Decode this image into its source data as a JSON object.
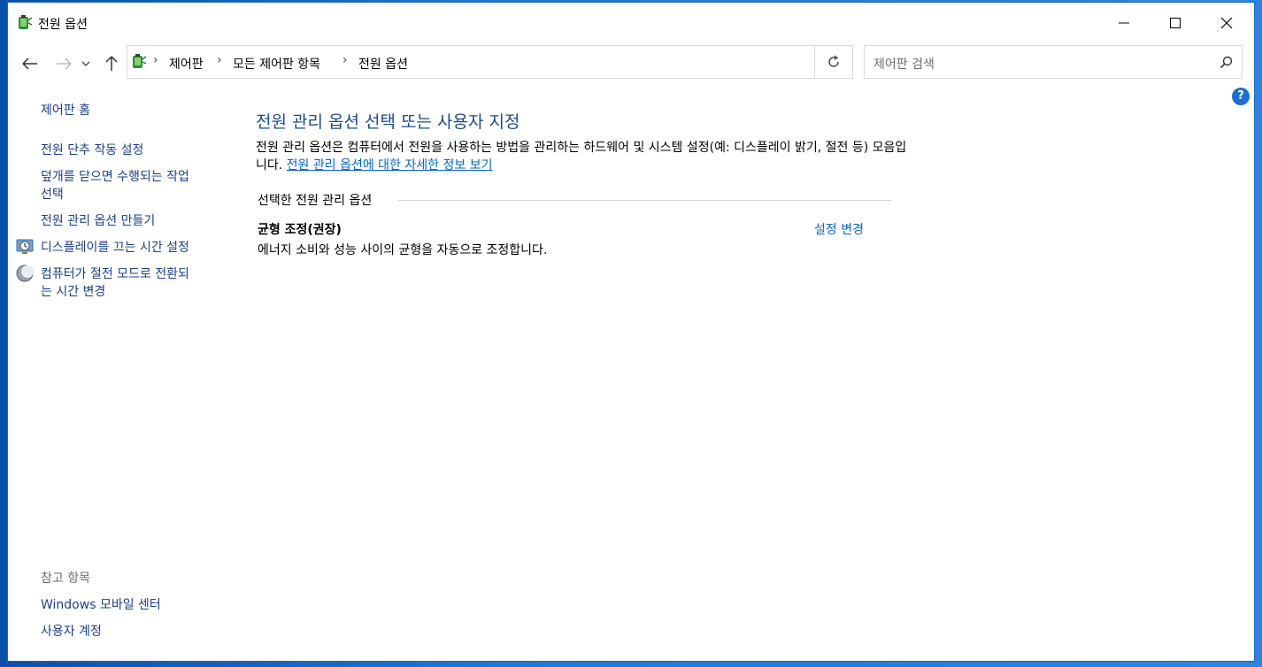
{
  "window": {
    "title": "전원 옵션",
    "minimize_glyph": "—",
    "maximize_glyph": "□",
    "close_glyph": "✕"
  },
  "navigation": {
    "back_icon": "arrow-left-icon",
    "forward_icon": "arrow-right-icon",
    "recent_icon": "chevron-down-icon",
    "up_icon": "arrow-up-icon",
    "breadcrumb": [
      "제어판",
      "모든 제어판 항목",
      "전원 옵션"
    ],
    "separator": "›",
    "refresh_icon": "refresh-icon",
    "search_placeholder": "제어판 검색"
  },
  "help": {
    "label": "?"
  },
  "sidebar": {
    "home": "제어판 홈",
    "tasks": [
      {
        "label": "전원 단추 작동 설정"
      },
      {
        "label": "덮개를 닫으면 수행되는 작업\n선택"
      },
      {
        "label": "전원 관리 옵션 만들기"
      },
      {
        "label": "디스플레이를 끄는 시간 설정",
        "icon": "display-clock-icon"
      },
      {
        "label": "컴퓨터가 절전 모드로 전환되\n는 시간 변경",
        "icon": "moon-icon"
      }
    ],
    "see_also_title": "참고 항목",
    "see_also": [
      "Windows 모바일 센터",
      "사용자 계정"
    ]
  },
  "main": {
    "title": "전원 관리 옵션 선택 또는 사용자 지정",
    "description": "전원 관리 옵션은 컴퓨터에서 전원을 사용하는 방법을 관리하는 하드웨어 및 시스템 설정(예: 디스플레이 밝기, 절전 등) 모음입니다.",
    "description_link": "전원 관리 옵션에 대한 자세한 정보 보기",
    "group_label": "선택한 전원 관리 옵션",
    "plan": {
      "name": "균형 조정(권장)",
      "change_link": "설정 변경",
      "description": "에너지 소비와 성능 사이의 균형을 자동으로 조정합니다."
    }
  },
  "colors": {
    "accent": "#1a4b93",
    "link": "#0066cc",
    "desktop": "#1e6fc8"
  }
}
